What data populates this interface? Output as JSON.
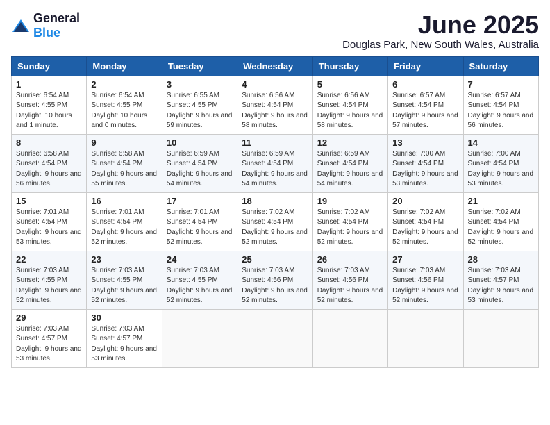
{
  "logo": {
    "general": "General",
    "blue": "Blue"
  },
  "title": "June 2025",
  "location": "Douglas Park, New South Wales, Australia",
  "days_header": [
    "Sunday",
    "Monday",
    "Tuesday",
    "Wednesday",
    "Thursday",
    "Friday",
    "Saturday"
  ],
  "weeks": [
    [
      {
        "day": "1",
        "sunrise": "Sunrise: 6:54 AM",
        "sunset": "Sunset: 4:55 PM",
        "daylight": "Daylight: 10 hours and 1 minute."
      },
      {
        "day": "2",
        "sunrise": "Sunrise: 6:54 AM",
        "sunset": "Sunset: 4:55 PM",
        "daylight": "Daylight: 10 hours and 0 minutes."
      },
      {
        "day": "3",
        "sunrise": "Sunrise: 6:55 AM",
        "sunset": "Sunset: 4:55 PM",
        "daylight": "Daylight: 9 hours and 59 minutes."
      },
      {
        "day": "4",
        "sunrise": "Sunrise: 6:56 AM",
        "sunset": "Sunset: 4:54 PM",
        "daylight": "Daylight: 9 hours and 58 minutes."
      },
      {
        "day": "5",
        "sunrise": "Sunrise: 6:56 AM",
        "sunset": "Sunset: 4:54 PM",
        "daylight": "Daylight: 9 hours and 58 minutes."
      },
      {
        "day": "6",
        "sunrise": "Sunrise: 6:57 AM",
        "sunset": "Sunset: 4:54 PM",
        "daylight": "Daylight: 9 hours and 57 minutes."
      },
      {
        "day": "7",
        "sunrise": "Sunrise: 6:57 AM",
        "sunset": "Sunset: 4:54 PM",
        "daylight": "Daylight: 9 hours and 56 minutes."
      }
    ],
    [
      {
        "day": "8",
        "sunrise": "Sunrise: 6:58 AM",
        "sunset": "Sunset: 4:54 PM",
        "daylight": "Daylight: 9 hours and 56 minutes."
      },
      {
        "day": "9",
        "sunrise": "Sunrise: 6:58 AM",
        "sunset": "Sunset: 4:54 PM",
        "daylight": "Daylight: 9 hours and 55 minutes."
      },
      {
        "day": "10",
        "sunrise": "Sunrise: 6:59 AM",
        "sunset": "Sunset: 4:54 PM",
        "daylight": "Daylight: 9 hours and 54 minutes."
      },
      {
        "day": "11",
        "sunrise": "Sunrise: 6:59 AM",
        "sunset": "Sunset: 4:54 PM",
        "daylight": "Daylight: 9 hours and 54 minutes."
      },
      {
        "day": "12",
        "sunrise": "Sunrise: 6:59 AM",
        "sunset": "Sunset: 4:54 PM",
        "daylight": "Daylight: 9 hours and 54 minutes."
      },
      {
        "day": "13",
        "sunrise": "Sunrise: 7:00 AM",
        "sunset": "Sunset: 4:54 PM",
        "daylight": "Daylight: 9 hours and 53 minutes."
      },
      {
        "day": "14",
        "sunrise": "Sunrise: 7:00 AM",
        "sunset": "Sunset: 4:54 PM",
        "daylight": "Daylight: 9 hours and 53 minutes."
      }
    ],
    [
      {
        "day": "15",
        "sunrise": "Sunrise: 7:01 AM",
        "sunset": "Sunset: 4:54 PM",
        "daylight": "Daylight: 9 hours and 53 minutes."
      },
      {
        "day": "16",
        "sunrise": "Sunrise: 7:01 AM",
        "sunset": "Sunset: 4:54 PM",
        "daylight": "Daylight: 9 hours and 52 minutes."
      },
      {
        "day": "17",
        "sunrise": "Sunrise: 7:01 AM",
        "sunset": "Sunset: 4:54 PM",
        "daylight": "Daylight: 9 hours and 52 minutes."
      },
      {
        "day": "18",
        "sunrise": "Sunrise: 7:02 AM",
        "sunset": "Sunset: 4:54 PM",
        "daylight": "Daylight: 9 hours and 52 minutes."
      },
      {
        "day": "19",
        "sunrise": "Sunrise: 7:02 AM",
        "sunset": "Sunset: 4:54 PM",
        "daylight": "Daylight: 9 hours and 52 minutes."
      },
      {
        "day": "20",
        "sunrise": "Sunrise: 7:02 AM",
        "sunset": "Sunset: 4:54 PM",
        "daylight": "Daylight: 9 hours and 52 minutes."
      },
      {
        "day": "21",
        "sunrise": "Sunrise: 7:02 AM",
        "sunset": "Sunset: 4:54 PM",
        "daylight": "Daylight: 9 hours and 52 minutes."
      }
    ],
    [
      {
        "day": "22",
        "sunrise": "Sunrise: 7:03 AM",
        "sunset": "Sunset: 4:55 PM",
        "daylight": "Daylight: 9 hours and 52 minutes."
      },
      {
        "day": "23",
        "sunrise": "Sunrise: 7:03 AM",
        "sunset": "Sunset: 4:55 PM",
        "daylight": "Daylight: 9 hours and 52 minutes."
      },
      {
        "day": "24",
        "sunrise": "Sunrise: 7:03 AM",
        "sunset": "Sunset: 4:55 PM",
        "daylight": "Daylight: 9 hours and 52 minutes."
      },
      {
        "day": "25",
        "sunrise": "Sunrise: 7:03 AM",
        "sunset": "Sunset: 4:56 PM",
        "daylight": "Daylight: 9 hours and 52 minutes."
      },
      {
        "day": "26",
        "sunrise": "Sunrise: 7:03 AM",
        "sunset": "Sunset: 4:56 PM",
        "daylight": "Daylight: 9 hours and 52 minutes."
      },
      {
        "day": "27",
        "sunrise": "Sunrise: 7:03 AM",
        "sunset": "Sunset: 4:56 PM",
        "daylight": "Daylight: 9 hours and 52 minutes."
      },
      {
        "day": "28",
        "sunrise": "Sunrise: 7:03 AM",
        "sunset": "Sunset: 4:57 PM",
        "daylight": "Daylight: 9 hours and 53 minutes."
      }
    ],
    [
      {
        "day": "29",
        "sunrise": "Sunrise: 7:03 AM",
        "sunset": "Sunset: 4:57 PM",
        "daylight": "Daylight: 9 hours and 53 minutes."
      },
      {
        "day": "30",
        "sunrise": "Sunrise: 7:03 AM",
        "sunset": "Sunset: 4:57 PM",
        "daylight": "Daylight: 9 hours and 53 minutes."
      },
      null,
      null,
      null,
      null,
      null
    ]
  ]
}
